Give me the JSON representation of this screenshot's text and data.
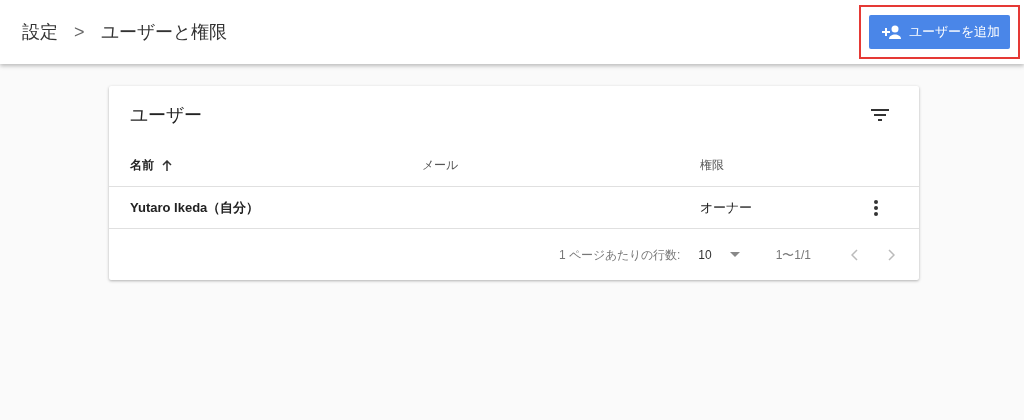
{
  "breadcrumb": [
    "設定",
    "ユーザーと権限"
  ],
  "breadcrumb_separator": ">",
  "add_button": {
    "label": "ユーザーを追加",
    "highlighted": true
  },
  "card": {
    "title": "ユーザー"
  },
  "table": {
    "columns": [
      {
        "label": "名前",
        "sorted": true
      },
      {
        "label": "メール",
        "sorted": false
      },
      {
        "label": "権限",
        "sorted": false
      }
    ],
    "rows": [
      {
        "name": "Yutaro Ikeda（自分）",
        "email": "",
        "role": "オーナー"
      }
    ]
  },
  "pagination": {
    "rows_per_page_label": "1 ページあたりの行数:",
    "rows_per_page": "10",
    "range": "1〜1/1"
  }
}
